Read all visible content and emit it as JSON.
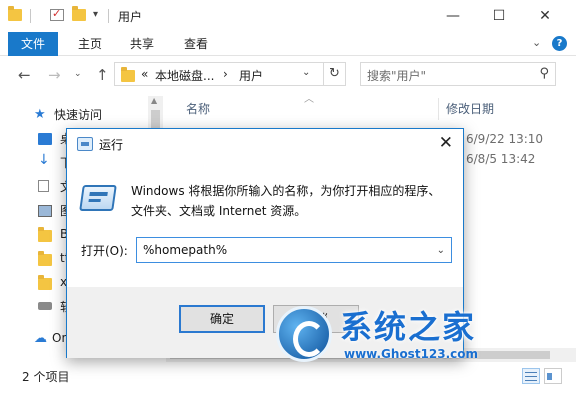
{
  "explorer": {
    "title": "用户",
    "ribbon_tabs": [
      "文件",
      "主页",
      "共享",
      "查看"
    ],
    "help_glyph": "?",
    "address": {
      "prefix": "«",
      "segments": [
        "本地磁盘...",
        "用户"
      ],
      "separator": "›"
    },
    "search_placeholder": "搜索\"用户\"",
    "sidebar": {
      "items": [
        "快速访问",
        "桌",
        "下",
        "文",
        "图",
        "B",
        "tt",
        "x",
        "软",
        "On"
      ]
    },
    "columns": {
      "name": "名称",
      "date": "修改日期"
    },
    "dates": [
      "6/9/22 13:10",
      "6/8/5 13:42"
    ],
    "status": "2 个项目"
  },
  "run_dialog": {
    "title": "运行",
    "description": "Windows 将根据你所输入的名称，为你打开相应的程序、文件夹、文档或 Internet 资源。",
    "open_label": "打开(O):",
    "input_value": "%homepath%",
    "ok_label": "确定",
    "cancel_label": "取消"
  },
  "watermark": {
    "title": "系统之家",
    "url": "www.Ghost123.com"
  },
  "colors": {
    "accent": "#1979ca",
    "folder": "#f4c542",
    "watermark": "#1a6fd0"
  }
}
